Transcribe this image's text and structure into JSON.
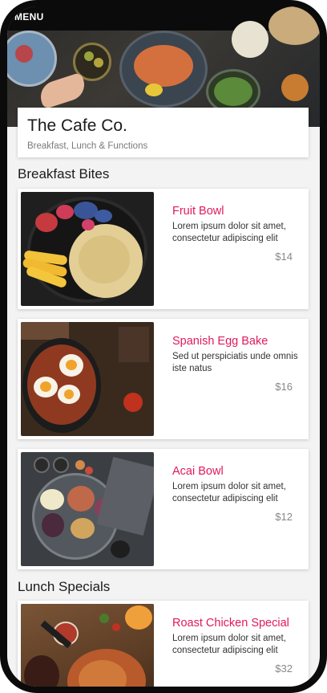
{
  "nav": {
    "menu_label": "MENU"
  },
  "header": {
    "title": "The Cafe Co.",
    "subtitle": "Breakfast, Lunch & Functions"
  },
  "sections": [
    {
      "title": "Breakfast Bites",
      "items": [
        {
          "name": "Fruit Bowl",
          "description": "Lorem ipsum dolor sit amet, consectetur adipiscing elit",
          "price": "$14"
        },
        {
          "name": "Spanish Egg Bake",
          "description": "Sed ut perspiciatis unde omnis iste natus",
          "price": "$16"
        },
        {
          "name": "Acai Bowl",
          "description": "Lorem ipsum dolor sit amet, consectetur adipiscing elit",
          "price": "$12"
        }
      ]
    },
    {
      "title": "Lunch Specials",
      "items": [
        {
          "name": "Roast Chicken Special",
          "description": "Lorem ipsum dolor sit amet, consectetur adipiscing elit",
          "price": "$32"
        }
      ]
    }
  ],
  "colors": {
    "accent": "#e0195f",
    "background": "#f3f3f3",
    "card": "#ffffff",
    "price": "#888888"
  }
}
